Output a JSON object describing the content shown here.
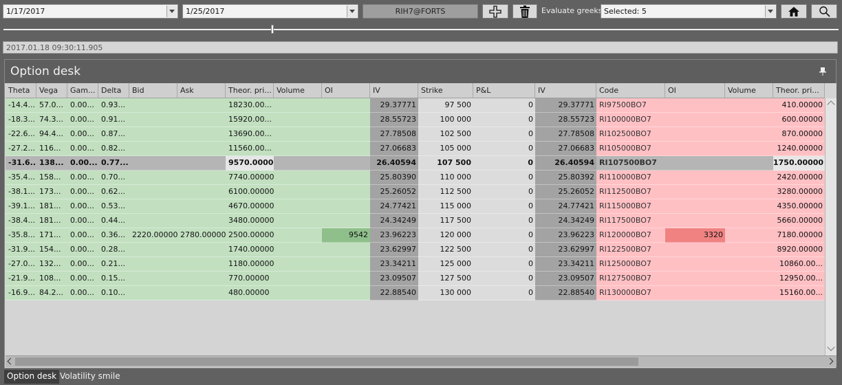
{
  "toolbar": {
    "date_from": "1/17/2017",
    "date_to": "1/25/2017",
    "ticker": "RIH7@FORTS",
    "evaluate_label": "Evaluate greeks:",
    "greeks_selection": "Selected: 5",
    "icons": [
      "add-icon",
      "trash-icon",
      "home-icon",
      "search-icon"
    ]
  },
  "timestamp": "2017.01.18 09:30:11.905",
  "panel": {
    "title": "Option desk"
  },
  "columns": [
    "Theta",
    "Vega",
    "Gam...",
    "Delta",
    "Bid",
    "Ask",
    "Theor. pri...",
    "Volume",
    "OI",
    "IV",
    "Strike",
    "P&L",
    "IV",
    "Code",
    "OI",
    "Volume",
    "Theor. pri..."
  ],
  "rows": [
    {
      "theta": "-14.4...",
      "vega": "57.0...",
      "gamma": "0.00...",
      "delta": "0.93...",
      "bid": "",
      "ask": "",
      "call_theor": "18230.00...",
      "call_volume": "",
      "call_oi": "",
      "call_iv": "29.37771",
      "strike": "97 500",
      "pnl": "0",
      "put_iv": "29.37771",
      "code": "RI97500BO7",
      "put_oi": "",
      "put_volume": "",
      "put_theor": "410.00000"
    },
    {
      "theta": "-18.3...",
      "vega": "74.3...",
      "gamma": "0.00...",
      "delta": "0.91...",
      "bid": "",
      "ask": "",
      "call_theor": "15920.00...",
      "call_volume": "",
      "call_oi": "",
      "call_iv": "28.55723",
      "strike": "100 000",
      "pnl": "0",
      "put_iv": "28.55723",
      "code": "RI100000BO7",
      "put_oi": "",
      "put_volume": "",
      "put_theor": "600.00000"
    },
    {
      "theta": "-22.6...",
      "vega": "94.4...",
      "gamma": "0.00...",
      "delta": "0.87...",
      "bid": "",
      "ask": "",
      "call_theor": "13690.00...",
      "call_volume": "",
      "call_oi": "",
      "call_iv": "27.78508",
      "strike": "102 500",
      "pnl": "0",
      "put_iv": "27.78508",
      "code": "RI102500BO7",
      "put_oi": "",
      "put_volume": "",
      "put_theor": "870.00000"
    },
    {
      "theta": "-27.2...",
      "vega": "116...",
      "gamma": "0.00...",
      "delta": "0.82...",
      "bid": "",
      "ask": "",
      "call_theor": "11560.00...",
      "call_volume": "",
      "call_oi": "",
      "call_iv": "27.06683",
      "strike": "105 000",
      "pnl": "0",
      "put_iv": "27.06683",
      "code": "RI105000BO7",
      "put_oi": "",
      "put_volume": "",
      "put_theor": "1240.00000"
    },
    {
      "theta": "-31.6...",
      "vega": "138...",
      "gamma": "0.00...",
      "delta": "0.77...",
      "bid": "",
      "ask": "",
      "call_theor": "9570.00000",
      "call_volume": "",
      "call_oi": "",
      "call_iv": "26.40594",
      "strike": "107 500",
      "pnl": "0",
      "put_iv": "26.40594",
      "code": "RI107500BO7",
      "put_oi": "",
      "put_volume": "",
      "put_theor": "1750.00000"
    },
    {
      "theta": "-35.4...",
      "vega": "158...",
      "gamma": "0.00...",
      "delta": "0.70...",
      "bid": "",
      "ask": "",
      "call_theor": "7740.00000",
      "call_volume": "",
      "call_oi": "",
      "call_iv": "25.80390",
      "strike": "110 000",
      "pnl": "0",
      "put_iv": "25.80392",
      "code": "RI110000BO7",
      "put_oi": "",
      "put_volume": "",
      "put_theor": "2420.00000"
    },
    {
      "theta": "-38.1...",
      "vega": "173...",
      "gamma": "0.00...",
      "delta": "0.62...",
      "bid": "",
      "ask": "",
      "call_theor": "6100.00000",
      "call_volume": "",
      "call_oi": "",
      "call_iv": "25.26052",
      "strike": "112 500",
      "pnl": "0",
      "put_iv": "25.26052",
      "code": "RI112500BO7",
      "put_oi": "",
      "put_volume": "",
      "put_theor": "3280.00000"
    },
    {
      "theta": "-39.1...",
      "vega": "181...",
      "gamma": "0.00...",
      "delta": "0.53...",
      "bid": "",
      "ask": "",
      "call_theor": "4670.00000",
      "call_volume": "",
      "call_oi": "",
      "call_iv": "24.77421",
      "strike": "115 000",
      "pnl": "0",
      "put_iv": "24.77421",
      "code": "RI115000BO7",
      "put_oi": "",
      "put_volume": "",
      "put_theor": "4350.00000"
    },
    {
      "theta": "-38.4...",
      "vega": "181...",
      "gamma": "0.00...",
      "delta": "0.44...",
      "bid": "",
      "ask": "",
      "call_theor": "3480.00000",
      "call_volume": "",
      "call_oi": "",
      "call_iv": "24.34249",
      "strike": "117 500",
      "pnl": "0",
      "put_iv": "24.34249",
      "code": "RI117500BO7",
      "put_oi": "",
      "put_volume": "",
      "put_theor": "5660.00000"
    },
    {
      "theta": "-35.8...",
      "vega": "171...",
      "gamma": "0.00...",
      "delta": "0.36...",
      "bid": "2220.00000",
      "ask": "2780.00000",
      "call_theor": "2500.00000",
      "call_volume": "",
      "call_oi": "9542",
      "call_iv": "23.96223",
      "strike": "120 000",
      "pnl": "0",
      "put_iv": "23.96223",
      "code": "RI120000BO7",
      "put_oi": "3320",
      "put_volume": "",
      "put_theor": "7180.00000"
    },
    {
      "theta": "-31.9...",
      "vega": "154...",
      "gamma": "0.00...",
      "delta": "0.28...",
      "bid": "",
      "ask": "",
      "call_theor": "1740.00000",
      "call_volume": "",
      "call_oi": "",
      "call_iv": "23.62997",
      "strike": "122 500",
      "pnl": "0",
      "put_iv": "23.62997",
      "code": "RI122500BO7",
      "put_oi": "",
      "put_volume": "",
      "put_theor": "8920.00000"
    },
    {
      "theta": "-27.0...",
      "vega": "132...",
      "gamma": "0.00...",
      "delta": "0.21...",
      "bid": "",
      "ask": "",
      "call_theor": "1180.00000",
      "call_volume": "",
      "call_oi": "",
      "call_iv": "23.34211",
      "strike": "125 000",
      "pnl": "0",
      "put_iv": "23.34211",
      "code": "RI125000BO7",
      "put_oi": "",
      "put_volume": "",
      "put_theor": "10860.00..."
    },
    {
      "theta": "-21.9...",
      "vega": "108...",
      "gamma": "0.00...",
      "delta": "0.15...",
      "bid": "",
      "ask": "",
      "call_theor": "770.00000",
      "call_volume": "",
      "call_oi": "",
      "call_iv": "23.09507",
      "strike": "127 500",
      "pnl": "0",
      "put_iv": "23.09507",
      "code": "RI127500BO7",
      "put_oi": "",
      "put_volume": "",
      "put_theor": "12950.00..."
    },
    {
      "theta": "-16.9...",
      "vega": "84.2...",
      "gamma": "0.00...",
      "delta": "0.10...",
      "bid": "",
      "ask": "",
      "call_theor": "480.00000",
      "call_volume": "",
      "call_oi": "",
      "call_iv": "22.88540",
      "strike": "130 000",
      "pnl": "0",
      "put_iv": "22.88540",
      "code": "RI130000BO7",
      "put_oi": "",
      "put_volume": "",
      "put_theor": "15160.00..."
    }
  ],
  "selected_row": 4,
  "tabs": [
    {
      "label": "Option desk",
      "active": true
    },
    {
      "label": "Volatility smile",
      "active": false
    }
  ],
  "colors": {
    "background": "#616161",
    "call_side": "#c2e0c0",
    "put_side": "#ffc0c4",
    "iv_shade": "#a3a3a3",
    "strike_shade": "#dcdcdc",
    "selected_row": "#b5b5b5",
    "call_oi_highlight": "#8fbf8b",
    "put_oi_highlight": "#f08282"
  }
}
